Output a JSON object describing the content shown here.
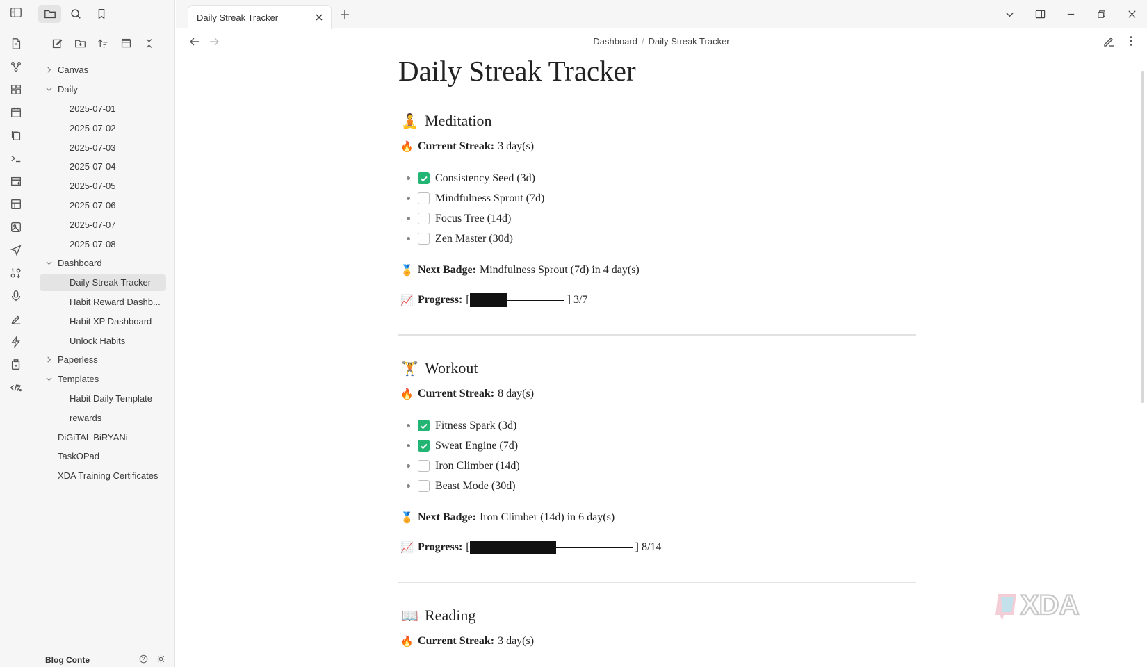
{
  "app": {
    "tab_title": "Daily Streak Tracker",
    "breadcrumb": [
      "Dashboard",
      "Daily Streak Tracker"
    ],
    "breadcrumb_sep": "/"
  },
  "sidebar": {
    "items": [
      {
        "label": "Canvas",
        "type": "folder",
        "expanded": false
      },
      {
        "label": "Daily",
        "type": "folder",
        "expanded": true
      },
      {
        "label": "2025-07-01",
        "type": "file"
      },
      {
        "label": "2025-07-02",
        "type": "file"
      },
      {
        "label": "2025-07-03",
        "type": "file"
      },
      {
        "label": "2025-07-04",
        "type": "file"
      },
      {
        "label": "2025-07-05",
        "type": "file"
      },
      {
        "label": "2025-07-06",
        "type": "file"
      },
      {
        "label": "2025-07-07",
        "type": "file"
      },
      {
        "label": "2025-07-08",
        "type": "file"
      },
      {
        "label": "Dashboard",
        "type": "folder",
        "expanded": true
      },
      {
        "label": "Daily Streak Tracker",
        "type": "file",
        "active": true
      },
      {
        "label": "Habit Reward Dashb...",
        "type": "file"
      },
      {
        "label": "Habit XP Dashboard",
        "type": "file"
      },
      {
        "label": "Unlock Habits",
        "type": "file"
      },
      {
        "label": "Paperless",
        "type": "folder",
        "expanded": false
      },
      {
        "label": "Templates",
        "type": "folder",
        "expanded": true
      },
      {
        "label": "Habit Daily Template",
        "type": "file"
      },
      {
        "label": "rewards",
        "type": "file"
      },
      {
        "label": "DiGiTAL BiRYANi",
        "type": "root-file"
      },
      {
        "label": "TaskOPad",
        "type": "root-file"
      },
      {
        "label": "XDA Training Certificates",
        "type": "root-file"
      }
    ],
    "footer_vault": "Blog Conte"
  },
  "document": {
    "title": "Daily Streak Tracker",
    "labels": {
      "current_streak": "Current Streak:",
      "next_badge": "Next Badge:",
      "progress": "Progress:"
    },
    "sections": [
      {
        "name": "Meditation",
        "emoji": "🧘",
        "streak_value": "3 day(s)",
        "badges": [
          {
            "label": "Consistency Seed (3d)",
            "checked": true
          },
          {
            "label": "Mindfulness Sprout (7d)",
            "checked": false
          },
          {
            "label": "Focus Tree (14d)",
            "checked": false
          },
          {
            "label": "Zen Master (30d)",
            "checked": false
          }
        ],
        "next_badge_value": "Mindfulness Sprout (7d) in 4 day(s)",
        "progress_current": 3,
        "progress_total": 7,
        "progress_text": "3/7"
      },
      {
        "name": "Workout",
        "emoji": "🏋",
        "streak_value": "8 day(s)",
        "badges": [
          {
            "label": "Fitness Spark (3d)",
            "checked": true
          },
          {
            "label": "Sweat Engine (7d)",
            "checked": true
          },
          {
            "label": "Iron Climber (14d)",
            "checked": false
          },
          {
            "label": "Beast Mode (30d)",
            "checked": false
          }
        ],
        "next_badge_value": "Iron Climber (14d) in 6 day(s)",
        "progress_current": 8,
        "progress_total": 14,
        "progress_text": "8/14"
      },
      {
        "name": "Reading",
        "emoji": "📖",
        "streak_value": "3 day(s)"
      }
    ]
  },
  "emojis": {
    "streak": "🔥",
    "badge": "🏅",
    "progress": "📈"
  },
  "colors": {
    "checkbox_checked": "#22b573",
    "sidebar_bg": "#f6f6f6",
    "active_item_bg": "#e4e4e4"
  },
  "watermark": "XDA"
}
